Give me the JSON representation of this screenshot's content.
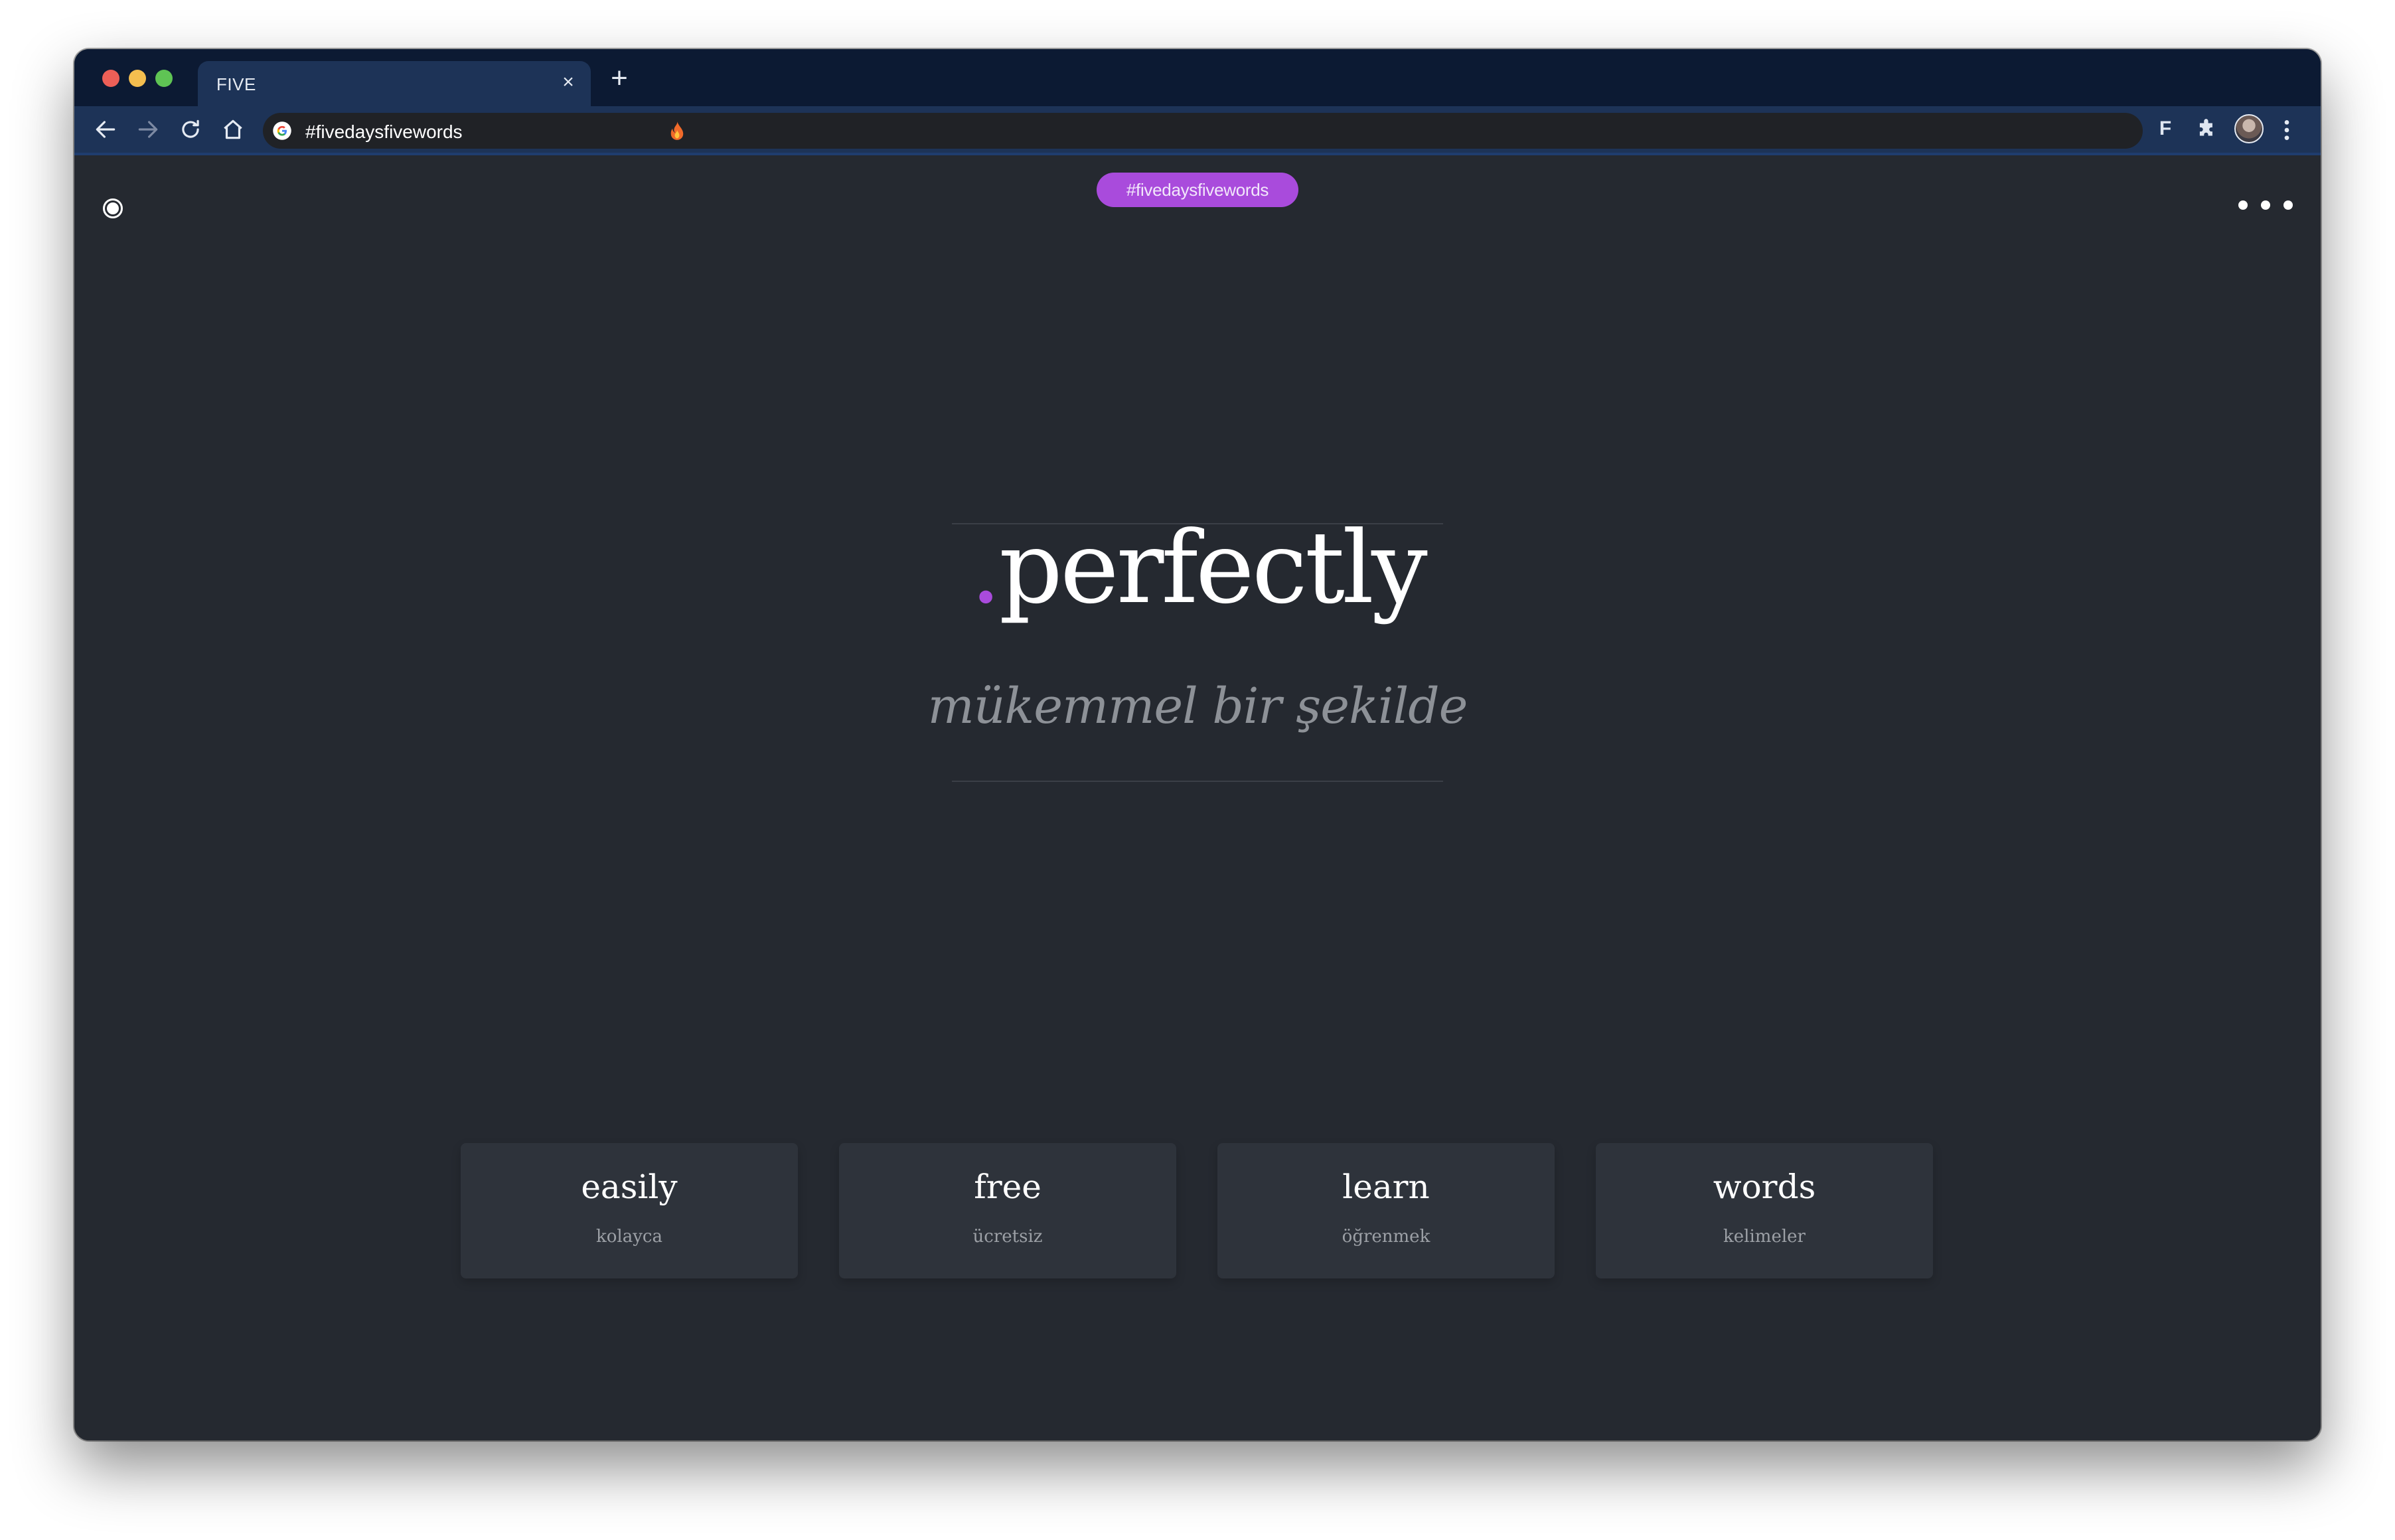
{
  "browser": {
    "tab_title": "FIVE",
    "tab_close_glyph": "×",
    "new_tab_glyph": "+",
    "url": "#fivedaysfivewords",
    "extension_f_label": "F",
    "icons": [
      "back-icon",
      "forward-icon",
      "reload-icon",
      "home-icon",
      "google-icon",
      "fire-icon",
      "puzzle-icon",
      "avatar",
      "kebab-menu-icon"
    ]
  },
  "page": {
    "hashtag": "#fivedaysfivewords",
    "accent_color": "#a94bdc",
    "background_color": "#252930",
    "card_color": "#2e333b",
    "hero": {
      "dot": ".",
      "word": "perfectly",
      "translation": "mükemmel bir şekilde"
    },
    "cards": [
      {
        "word": "easily",
        "translation": "kolayca"
      },
      {
        "word": "free",
        "translation": "ücretsiz"
      },
      {
        "word": "learn",
        "translation": "öğrenmek"
      },
      {
        "word": "words",
        "translation": "kelimeler"
      }
    ]
  }
}
